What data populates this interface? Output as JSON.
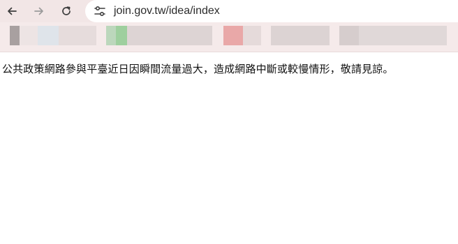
{
  "browser": {
    "url": "join.gov.tw/idea/index",
    "icons": {
      "back": "back-arrow-icon",
      "forward": "forward-arrow-icon",
      "reload": "reload-icon",
      "site_info": "tune-icon"
    }
  },
  "page": {
    "message": "公共政策網路參與平臺近日因瞬間流量過大，造成網路中斷或較慢情形，敬請見諒。"
  },
  "colors": {
    "toolbar_bg": "#f2e6e6",
    "bookmarks_bg": "#f5eaea",
    "page_bg": "#ffffff",
    "text": "#111111"
  }
}
